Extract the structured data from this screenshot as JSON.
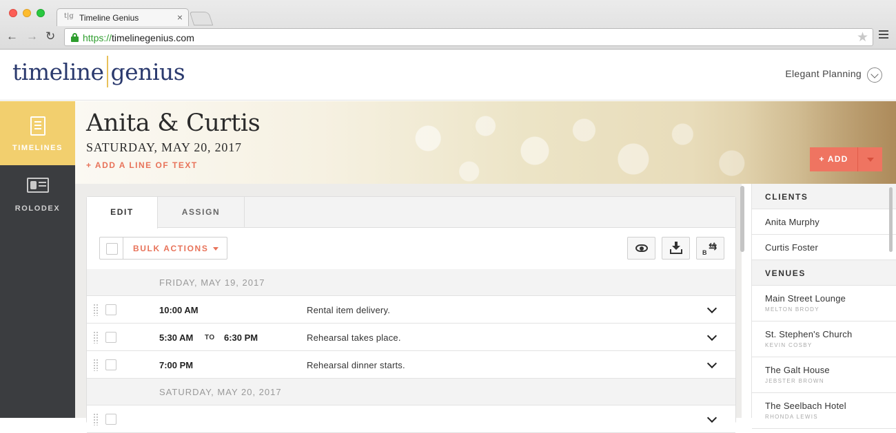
{
  "browser": {
    "tab_title": "Timeline Genius",
    "tab_favicon": "t|g",
    "tab_close": "×",
    "url_scheme": "https://",
    "url_host": "timelinegenius.com"
  },
  "header": {
    "logo_left": "timeline",
    "logo_right": "genius",
    "account_name": "Elegant Planning"
  },
  "sidebar": {
    "items": [
      {
        "label": "TIMELINES",
        "icon": "document-icon",
        "active": true
      },
      {
        "label": "ROLODEX",
        "icon": "contact-card-icon",
        "active": false
      }
    ]
  },
  "hero": {
    "title": "Anita & Curtis",
    "date": "SATURDAY, MAY 20, 2017",
    "add_line": "+ ADD A LINE OF TEXT",
    "add_button": "+ ADD"
  },
  "panel": {
    "tabs": [
      "EDIT",
      "ASSIGN"
    ],
    "bulk_actions": "BULK ACTIONS",
    "days": [
      {
        "date": "FRIDAY, MAY 19, 2017",
        "events": [
          {
            "start": "10:00 AM",
            "to": "",
            "end": "",
            "description": "Rental item delivery."
          },
          {
            "start": "5:30 AM",
            "to": "TO",
            "end": "6:30 PM",
            "description": "Rehearsal takes place."
          },
          {
            "start": "7:00 PM",
            "to": "",
            "end": "",
            "description": "Rehearsal dinner starts."
          }
        ]
      },
      {
        "date": "SATURDAY, MAY 20, 2017",
        "events": []
      }
    ]
  },
  "right_panel": {
    "clients_heading": "CLIENTS",
    "clients": [
      "Anita Murphy",
      "Curtis Foster"
    ],
    "venues_heading": "VENUES",
    "venues": [
      {
        "name": "Main Street Lounge",
        "contact": "MELTON BRODY"
      },
      {
        "name": "St. Stephen's Church",
        "contact": "KEVIN COSBY"
      },
      {
        "name": "The Galt House",
        "contact": "JEBSTER BROWN"
      },
      {
        "name": "The Seelbach Hotel",
        "contact": "RHONDA LEWIS"
      }
    ]
  },
  "colors": {
    "accent_coral": "#ef7461",
    "sidebar_active": "#f2cf6e",
    "sidebar_bg": "#3b3d40",
    "logo_navy": "#2b3a6e",
    "logo_bar_gold": "#e8c15a"
  }
}
